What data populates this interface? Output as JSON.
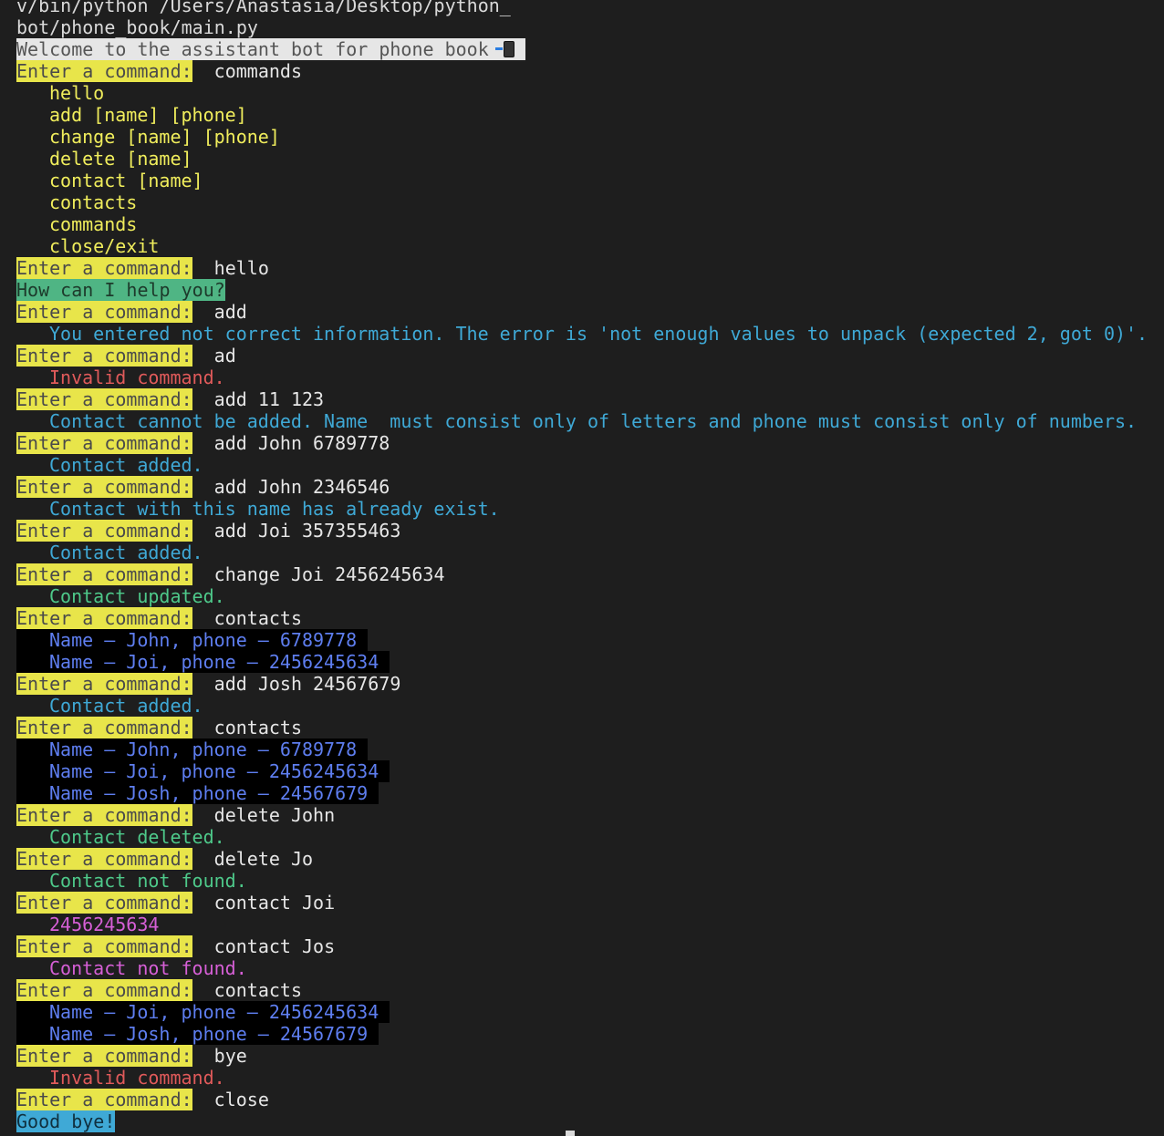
{
  "header": {
    "path_line1": "v/bin/python /Users/Anastasia/Desktop/python_",
    "path_line2": "bot/phone_book/main.py",
    "welcome": "Welcome to the assistant bot for phone book "
  },
  "prompt_label": "Enter a command:",
  "commands_list": [
    "hello",
    "add [name] [phone]",
    "change [name] [phone]",
    "delete [name]",
    "contact [name]",
    "contacts",
    "commands",
    "close/exit"
  ],
  "inputs": [
    "commands",
    "hello",
    "add",
    "ad",
    "add 11 123",
    "add John 6789778",
    "add John 2346546",
    "add Joi 357355463",
    "change Joi 2456245634",
    "contacts",
    "add Josh 24567679",
    "contacts",
    "delete John",
    "delete Jo",
    "contact Joi",
    "contact Jos",
    "contacts",
    "bye",
    "close"
  ],
  "outputs": {
    "greeting": "How can I help you?",
    "unpack_error": "You entered not correct information. The error is 'not enough values to unpack (expected 2, got 0)'.",
    "invalid_1": "Invalid command.",
    "cannot_add": "Contact cannot be added. Name  must consist only of letters and phone must consist only of numbers.",
    "added_1": "Contact added.",
    "exists": "Contact with this name has already exist.",
    "added_2": "Contact added.",
    "updated": "Contact updated.",
    "added_3": "Contact added.",
    "deleted": "Contact deleted.",
    "not_found_1": "Contact not found.",
    "phone_result": "2456245634",
    "not_found_2": "Contact not found.",
    "invalid_2": "Invalid command.",
    "goodbye": "Good bye!"
  },
  "contacts_1": [
    "Name – John, phone – 6789778 ",
    "Name – Joi, phone – 2456245634 "
  ],
  "contacts_2": [
    "Name – John, phone – 6789778 ",
    "Name – Joi, phone – 2456245634 ",
    "Name – Josh, phone – 24567679 "
  ],
  "contacts_3": [
    "Name – Joi, phone – 2456245634 ",
    "Name – Josh, phone – 24567679 "
  ],
  "colors": {
    "prompt_bg": "#e8e54a",
    "info": "#3fa9d6",
    "error": "#e05a5a",
    "success": "#4ec98a",
    "magenta": "#d65fd6",
    "contact_text": "#5e7ef0",
    "command_list": "#f0ed5c"
  },
  "icons": {
    "welcome_icon": "mobile-phone-icon"
  }
}
